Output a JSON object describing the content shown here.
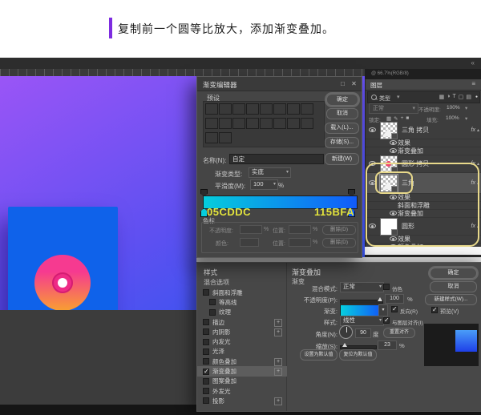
{
  "header": {
    "text": "复制前一个圆等比放大，添加渐变叠加。",
    "accent_color": "#7d2ce0"
  },
  "icons": {
    "caret_down": "▾",
    "caret_up": "▴",
    "gear": "⚙",
    "menu": "≡",
    "close": "✕",
    "maximize": "□",
    "check": "✓",
    "collapse": "«",
    "dot": "●",
    "plus": "+"
  },
  "dock": {
    "tab_info": "@ 66.7%(RGB/8)"
  },
  "canvas": {
    "bg": "linear-gradient(150deg,#9a55f6 0%,#5e50f1 55%,#2b55ee 100%)",
    "card_color": "#0f62ea",
    "circle_gradient": "linear-gradient(180deg,#f63a90 30%,#f89f31 100%)",
    "inner_circle": "#ee2b86",
    "triangle_gradient": "linear-gradient(180deg,#33d5da 0%,#1b5ff0 100%)"
  },
  "layers_panel": {
    "tab": "图层",
    "filter_label": "类型",
    "filter_icons": [
      "▦",
      "◑",
      "T",
      "▢",
      "▤"
    ],
    "blend_mode": "正常",
    "opacity_label": "不透明度:",
    "opacity_value": "100%",
    "lock_label": "锁定:",
    "lock_icons": [
      "▦",
      "✎",
      "+",
      "■"
    ],
    "fill_label": "填充:",
    "fill_value": "100%",
    "fx_label": "fx",
    "rows": [
      {
        "name": "三角 拷贝",
        "classes": "layer thumb-tri"
      },
      {
        "name": "效果",
        "classes": "effect"
      },
      {
        "name": "渐变叠加",
        "classes": "effect"
      },
      {
        "name": "圆形 拷贝",
        "classes": "layer thumb-dot"
      },
      {
        "name": "三角",
        "classes": "layer thumb-tri selected"
      },
      {
        "name": "效果",
        "classes": "effect"
      },
      {
        "name": "斜面和浮雕",
        "classes": "effect no-eye"
      },
      {
        "name": "渐变叠加",
        "classes": "effect"
      },
      {
        "name": "圆形",
        "classes": "layer thumb-white"
      },
      {
        "name": "效果",
        "classes": "effect"
      },
      {
        "name": "颜色叠加",
        "classes": "effect"
      }
    ],
    "highlight_color": "#e8d98b"
  },
  "gradient_editor": {
    "title": "渐变编辑器",
    "presets_label": "预设",
    "ok": "确定",
    "cancel": "取消",
    "load": "载入(L)...",
    "save": "存储(S)...",
    "new": "新建(W)",
    "name_label": "名称(N):",
    "name_value": "自定",
    "type_label": "渐变类型:",
    "type_value": "实底",
    "smooth_label": "平滑度(M):",
    "smooth_value": "100",
    "percent": "%",
    "bar_css": "linear-gradient(90deg,#05cddc,#115bfa)",
    "start_hex": "05CDDC",
    "end_hex": "115BFA",
    "start_color": "#05cddc",
    "end_color": "#115bfa",
    "annotation_color": "#e3e43c",
    "stops_label": "色标",
    "stop_opacity_label": "不透明度:",
    "stop_position_label": "位置:",
    "stop_color_label": "颜色:",
    "delete_label": "删除(D)",
    "presets": [
      {
        "css": "linear-gradient(135deg,#ffffff,#8a8a8a),repeating-conic-gradient(#b8b8b8 0% 25%,#ffffff 0% 50%)"
      },
      {
        "css": "linear-gradient(135deg,#ffffff 30%,rgba(255,255,255,0) 75%),repeating-conic-gradient(#b8b8b8 0% 25%,#ffffff 0% 50%)"
      },
      {
        "css": "linear-gradient(135deg,#000000,#ffffff),repeating-conic-gradient(#b8b8b8 0% 25%,#ffffff 0% 50%)"
      },
      {
        "css": "linear-gradient(135deg,#e03a28,#5a0c06),repeating-conic-gradient(#b8b8b8 0% 25%,#ffffff 0% 50%)"
      },
      {
        "css": "linear-gradient(135deg,#f08a20,#7a3c08),repeating-conic-gradient(#b8b8b8 0% 25%,#ffffff 0% 50%)"
      },
      {
        "css": "linear-gradient(135deg,#2a3fd4 0%,#8a30c0 50%,#d03030 100%),repeating-conic-gradient(#b8b8b8 0% 25%,#ffffff 0% 50%)"
      },
      {
        "css": "linear-gradient(135deg,#e03030,#e0e030,#30c040,#3090e0,#7030c0),repeating-conic-gradient(#b8b8b8 0% 25%,#ffffff 0% 50%)"
      },
      {
        "css": "linear-gradient(135deg,#f0a020,#f8e060 40%,#e07010 70%,#f8c040),repeating-conic-gradient(#b8b8b8 0% 25%,#ffffff 0% 50%)"
      },
      {
        "css": "linear-gradient(135deg,#c09030,#f0d878,#8a6010),repeating-conic-gradient(#b8b8b8 0% 25%,#ffffff 0% 50%)"
      },
      {
        "css": "linear-gradient(135deg,#7828a8,#e06828 55%,#f0c830),repeating-conic-gradient(#b8b8b8 0% 25%,#ffffff 0% 50%)"
      },
      {
        "css": "linear-gradient(135deg,#181818,#d02020 40%,#f0d020 70%,#2858d0),repeating-conic-gradient(#b8b8b8 0% 25%,#ffffff 0% 50%)"
      },
      {
        "css": "linear-gradient(135deg,#8a4818,#e8a860 50%,#5a2c08),repeating-conic-gradient(#b8b8b8 0% 25%,#ffffff 0% 50%)"
      },
      {
        "css": "linear-gradient(135deg,#f070a0,#c01040),repeating-conic-gradient(#b8b8b8 0% 25%,#ffffff 0% 50%)"
      },
      {
        "css": "linear-gradient(135deg,#2848d8,#e82860 50%,#f8d838),repeating-conic-gradient(#b8b8b8 0% 25%,#ffffff 0% 50%)"
      },
      {
        "css": "linear-gradient(90deg,#10c8e8,#1050d8 35%,#10c070 70%,#08a8d8),repeating-conic-gradient(#b8b8b8 0% 25%,#ffffff 0% 50%)"
      },
      {
        "css": "linear-gradient(135deg,#f8c030,#e86810),repeating-conic-gradient(#b8b8b8 0% 25%,#ffffff 0% 50%)"
      },
      {
        "css": "linear-gradient(rgba(0,0,0,0),rgba(0,0,0,0)),repeating-conic-gradient(#b8b8b8 0% 25%,#ffffff 0% 50%)"
      },
      {
        "css": "linear-gradient(rgba(0,0,0,0),rgba(0,0,0,0)),repeating-conic-gradient(#b8b8b8 0% 25%,#ffffff 0% 50%)"
      }
    ]
  },
  "layer_style": {
    "styles_title": "样式",
    "blending_options": "混合选项",
    "items": [
      {
        "label": "斜面和浮雕",
        "classes": ""
      },
      {
        "label": "等高线",
        "classes": "indent"
      },
      {
        "label": "纹理",
        "classes": "indent"
      },
      {
        "label": "描边",
        "classes": "plus"
      },
      {
        "label": "内阴影",
        "classes": "plus"
      },
      {
        "label": "内发光",
        "classes": ""
      },
      {
        "label": "光泽",
        "classes": ""
      },
      {
        "label": "颜色叠加",
        "classes": "plus"
      },
      {
        "label": "渐变叠加",
        "classes": "plus checked selected"
      },
      {
        "label": "图案叠加",
        "classes": ""
      },
      {
        "label": "外发光",
        "classes": ""
      },
      {
        "label": "投影",
        "classes": "plus"
      }
    ],
    "panel_title": "渐变叠加",
    "section_label": "渐变",
    "blend_label": "混合模式:",
    "blend_value": "正常",
    "dither": "仿色",
    "opacity_label": "不透明度(P):",
    "opacity_value": "100",
    "percent": "%",
    "gradient_label": "渐变:",
    "gradient_css": "linear-gradient(90deg,#06cfe0,#1160f5)",
    "reverse": "反向(R)",
    "style_label": "样式:",
    "style_value": "线性",
    "align": "与图层对齐(I)",
    "angle_label": "角度(N):",
    "angle_value": "90",
    "degree": "度",
    "reset_align": "重置对齐",
    "scale_label": "缩放(S):",
    "scale_value": "23",
    "set_default": "设置为默认值",
    "reset_default": "复位为默认值",
    "ok": "确定",
    "cancel": "取消",
    "new_style": "新建样式(W)...",
    "preview": "预览(V)",
    "preview_css": "linear-gradient(180deg,#4a9df8 0%,#1e3fe8 100%)"
  }
}
